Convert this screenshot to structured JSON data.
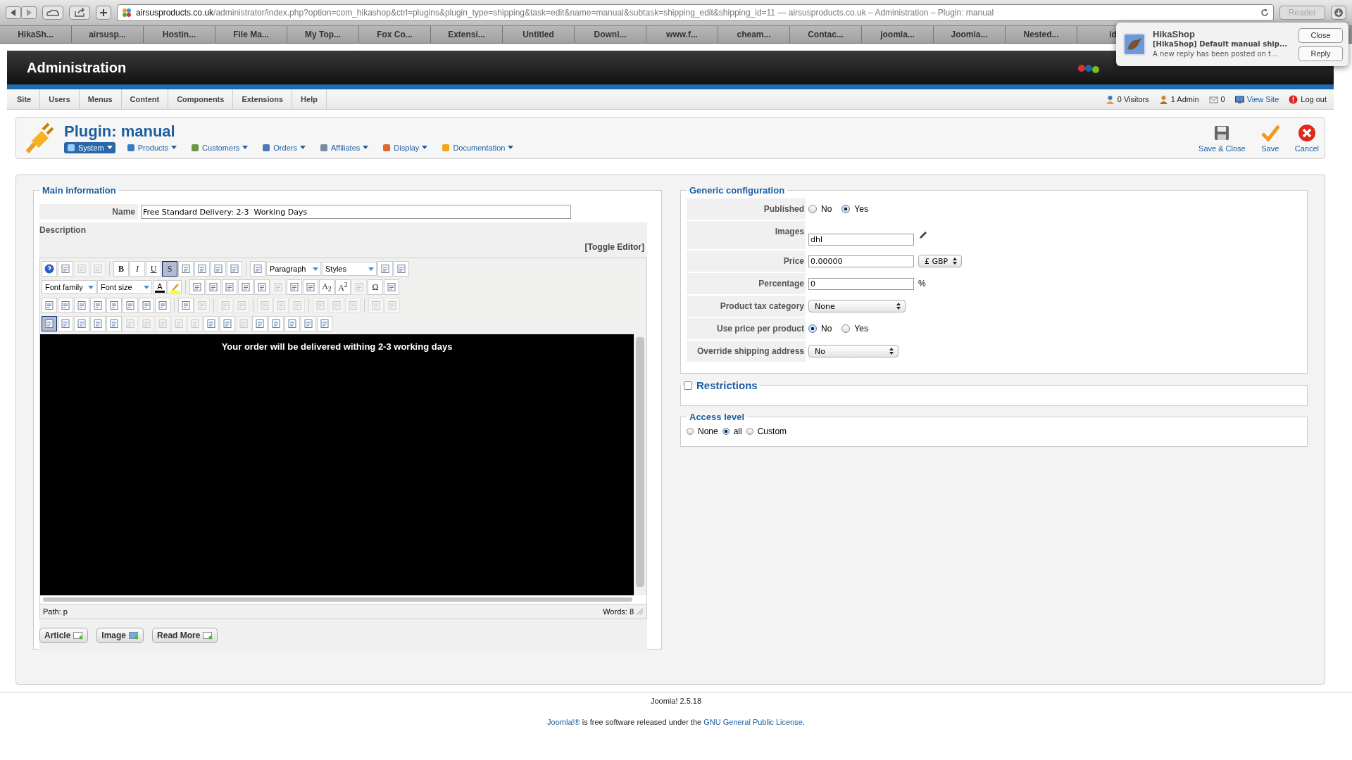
{
  "browser": {
    "url_host": "airsusproducts.co.uk",
    "url_path": "/administrator/index.php?option=com_hikashop&ctrl=plugins&plugin_type=shipping&task=edit&name=manual&subtask=shipping_edit&shipping_id=11",
    "page_title": "— airsusproducts.co.uk – Administration – Plugin: manual",
    "reader": "Reader",
    "tabs": [
      "HikaSh...",
      "airsusp...",
      "Hostin...",
      "File Ma...",
      "My Top...",
      "Fox Co...",
      "Extensi...",
      "Untitled",
      "Downl...",
      "www.f...",
      "cheam...",
      "Contac...",
      "joomla...",
      "Joomla...",
      "Nested...",
      "id"
    ]
  },
  "notification": {
    "app": "HikaShop",
    "subject": "[HikaShop] Default manual ship...",
    "body": "A new reply has been posted on t...",
    "buttons": [
      "Close",
      "Reply"
    ]
  },
  "header": {
    "title": "Administration"
  },
  "menu": [
    "Site",
    "Users",
    "Menus",
    "Content",
    "Components",
    "Extensions",
    "Help"
  ],
  "status": [
    {
      "kind": "visitors",
      "label": "0 Visitors"
    },
    {
      "kind": "admin",
      "label": "1 Admin"
    },
    {
      "kind": "messages",
      "label": "0"
    },
    {
      "kind": "site",
      "label": "View Site"
    },
    {
      "kind": "logout",
      "label": "Log out"
    }
  ],
  "page_title": "Plugin: manual",
  "submenu": [
    {
      "label": "System",
      "selected": true
    },
    {
      "label": "Products",
      "selected": false
    },
    {
      "label": "Customers",
      "selected": false
    },
    {
      "label": "Orders",
      "selected": false
    },
    {
      "label": "Affiliates",
      "selected": false
    },
    {
      "label": "Display",
      "selected": false
    },
    {
      "label": "Documentation",
      "selected": false
    }
  ],
  "actions": [
    {
      "kind": "save-close",
      "label": "Save & Close"
    },
    {
      "kind": "save",
      "label": "Save"
    },
    {
      "kind": "cancel",
      "label": "Cancel"
    }
  ],
  "main": {
    "legend": "Main information",
    "name_label": "Name",
    "name_value": "Free Standard Delivery: 2-3  Working Days",
    "description_label": "Description",
    "toggle": "[Toggle Editor]",
    "toolbar": [
      {
        "items": [
          {
            "kind": "help"
          },
          {
            "kind": "icon",
            "disabled": false,
            "selected": false
          },
          {
            "kind": "icon",
            "disabled": true,
            "selected": false
          },
          {
            "kind": "icon",
            "disabled": true,
            "selected": false
          },
          {
            "kind": "sep"
          },
          {
            "kind": "bold",
            "label": "B",
            "selected": false
          },
          {
            "kind": "italic",
            "label": "I",
            "selected": false
          },
          {
            "kind": "underline",
            "label": "U",
            "selected": false
          },
          {
            "kind": "strike",
            "label": "S",
            "selected": true
          },
          {
            "kind": "icon",
            "disabled": false,
            "selected": false
          },
          {
            "kind": "icon",
            "disabled": false,
            "selected": false
          },
          {
            "kind": "icon",
            "disabled": false,
            "selected": false
          },
          {
            "kind": "icon",
            "disabled": false,
            "selected": false
          },
          {
            "kind": "sep"
          },
          {
            "kind": "icon",
            "disabled": false,
            "selected": false
          },
          {
            "kind": "select",
            "label": "Paragraph"
          },
          {
            "kind": "select",
            "label": "Styles"
          },
          {
            "kind": "icon",
            "disabled": false,
            "selected": false
          },
          {
            "kind": "icon",
            "disabled": false,
            "selected": false
          }
        ]
      },
      {
        "items": [
          {
            "kind": "select",
            "label": "Font family"
          },
          {
            "kind": "select",
            "label": "Font size"
          },
          {
            "kind": "color",
            "label": "A",
            "color": "#000000"
          },
          {
            "kind": "color",
            "color": "#ffff00"
          },
          {
            "kind": "sep"
          },
          {
            "kind": "icon",
            "disabled": false,
            "selected": false
          },
          {
            "kind": "icon",
            "disabled": false,
            "selected": false
          },
          {
            "kind": "icon",
            "disabled": false,
            "selected": false
          },
          {
            "kind": "icon",
            "disabled": false,
            "selected": false
          },
          {
            "kind": "icon",
            "disabled": false,
            "selected": false
          },
          {
            "kind": "icon",
            "disabled": true,
            "selected": false
          },
          {
            "kind": "icon",
            "disabled": false,
            "selected": false
          },
          {
            "kind": "icon",
            "disabled": false,
            "selected": false
          },
          {
            "kind": "glyph",
            "label": "A$_{2}$",
            "selected": false
          },
          {
            "kind": "glyph",
            "label": "A$^{2}$",
            "selected": false
          },
          {
            "kind": "icon",
            "disabled": true,
            "selected": false
          },
          {
            "kind": "glyph",
            "label": "Ω",
            "selected": false
          },
          {
            "kind": "icon",
            "disabled": false,
            "selected": false
          }
        ]
      },
      {
        "items": [
          {
            "kind": "icon",
            "disabled": false,
            "selected": false
          },
          {
            "kind": "icon",
            "disabled": false,
            "selected": false
          },
          {
            "kind": "icon",
            "disabled": false,
            "selected": false
          },
          {
            "kind": "icon",
            "disabled": false,
            "selected": false
          },
          {
            "kind": "icon",
            "disabled": false,
            "selected": false
          },
          {
            "kind": "icon",
            "disabled": false,
            "selected": false
          },
          {
            "kind": "icon",
            "disabled": false,
            "selected": false
          },
          {
            "kind": "icon",
            "disabled": false,
            "selected": false
          },
          {
            "kind": "sep"
          },
          {
            "kind": "icon",
            "disabled": false,
            "selected": false
          },
          {
            "kind": "icon",
            "disabled": true,
            "selected": false
          },
          {
            "kind": "sep"
          },
          {
            "kind": "icon",
            "disabled": true,
            "selected": false
          },
          {
            "kind": "icon",
            "disabled": true,
            "selected": false
          },
          {
            "kind": "sep"
          },
          {
            "kind": "icon",
            "disabled": true,
            "selected": false
          },
          {
            "kind": "icon",
            "disabled": true,
            "selected": false
          },
          {
            "kind": "icon",
            "disabled": true,
            "selected": false
          },
          {
            "kind": "sep"
          },
          {
            "kind": "icon",
            "disabled": true,
            "selected": false
          },
          {
            "kind": "icon",
            "disabled": true,
            "selected": false
          },
          {
            "kind": "icon",
            "disabled": true,
            "selected": false
          },
          {
            "kind": "sep"
          },
          {
            "kind": "icon",
            "disabled": true,
            "selected": false
          },
          {
            "kind": "icon",
            "disabled": true,
            "selected": false
          }
        ]
      },
      {
        "items": [
          {
            "kind": "icon",
            "disabled": false,
            "selected": true
          },
          {
            "kind": "icon",
            "disabled": false,
            "selected": false
          },
          {
            "kind": "icon",
            "disabled": false,
            "selected": false
          },
          {
            "kind": "icon",
            "disabled": false,
            "selected": false
          },
          {
            "kind": "icon",
            "disabled": false,
            "selected": false
          },
          {
            "kind": "icon",
            "disabled": true,
            "selected": false
          },
          {
            "kind": "icon",
            "disabled": true,
            "selected": false
          },
          {
            "kind": "icon",
            "disabled": true,
            "selected": false
          },
          {
            "kind": "icon",
            "disabled": true,
            "selected": false
          },
          {
            "kind": "icon",
            "disabled": true,
            "selected": false
          },
          {
            "kind": "icon",
            "disabled": false,
            "selected": false
          },
          {
            "kind": "icon",
            "disabled": false,
            "selected": false
          },
          {
            "kind": "icon",
            "disabled": true,
            "selected": false
          },
          {
            "kind": "icon",
            "disabled": false,
            "selected": false
          },
          {
            "kind": "icon",
            "disabled": false,
            "selected": false
          },
          {
            "kind": "icon",
            "disabled": false,
            "selected": false
          },
          {
            "kind": "icon",
            "disabled": false,
            "selected": false
          },
          {
            "kind": "icon",
            "disabled": false,
            "selected": false
          }
        ]
      }
    ],
    "content": "Your order will be delivered withing 2-3 working days",
    "path": "Path:  p",
    "words": "Words: 8",
    "buttons": [
      "Article",
      "Image",
      "Read More"
    ]
  },
  "generic": {
    "legend": "Generic configuration",
    "rows": [
      {
        "kind": "radio",
        "label": "Published",
        "options": [
          {
            "label": "No",
            "selected": false
          },
          {
            "label": "Yes",
            "selected": true
          }
        ]
      },
      {
        "kind": "image",
        "label": "Images",
        "value": "dhl"
      },
      {
        "kind": "price",
        "label": "Price",
        "value": "0.00000",
        "currency": "£ GBP"
      },
      {
        "kind": "percent",
        "label": "Percentage",
        "value": "0",
        "unit": "%"
      },
      {
        "kind": "select",
        "label": "Product tax category",
        "value": "None"
      },
      {
        "kind": "radio",
        "label": "Use price per product",
        "options": [
          {
            "label": "No",
            "selected": true
          },
          {
            "label": "Yes",
            "selected": false
          }
        ]
      },
      {
        "kind": "select",
        "label": "Override shipping address",
        "value": "No"
      }
    ]
  },
  "restrictions": {
    "legend": "Restrictions",
    "checked": false
  },
  "access": {
    "legend": "Access level",
    "options": [
      {
        "label": "None",
        "selected": false
      },
      {
        "label": "all",
        "selected": true
      },
      {
        "label": "Custom",
        "selected": false
      }
    ]
  },
  "footer": {
    "version": "Joomla! 2.5.18",
    "license_link1": "Joomla!®",
    "license_text": "is free software released under the",
    "license_link2": "GNU General Public License",
    "license_end": "."
  }
}
